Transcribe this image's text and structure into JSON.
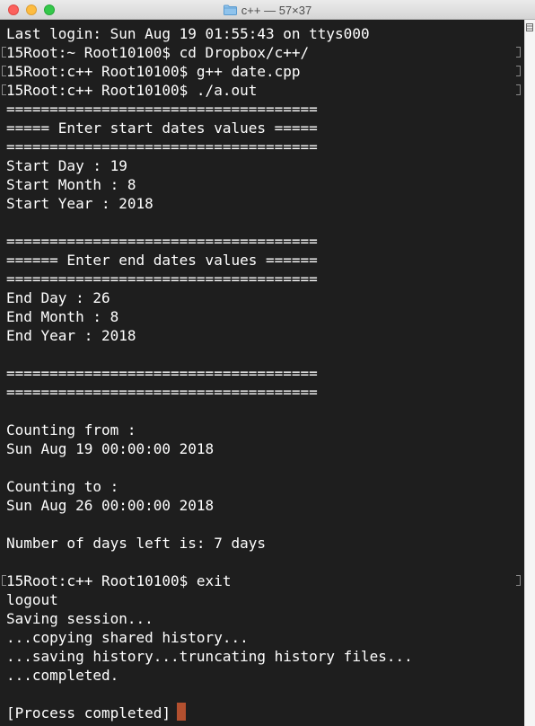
{
  "window": {
    "title": "c++ — 57×37"
  },
  "terminal": {
    "lines": [
      "Last login: Sun Aug 19 01:55:43 on ttys000",
      "15Root:~ Root10100$ cd Dropbox/c++/",
      "15Root:c++ Root10100$ g++ date.cpp",
      "15Root:c++ Root10100$ ./a.out",
      "====================================",
      "===== Enter start dates values =====",
      "====================================",
      "Start Day : 19",
      "Start Month : 8",
      "Start Year : 2018",
      "",
      "====================================",
      "====== Enter end dates values ======",
      "====================================",
      "End Day : 26",
      "End Month : 8",
      "End Year : 2018",
      "",
      "====================================",
      "====================================",
      "",
      "Counting from :",
      "Sun Aug 19 00:00:00 2018",
      "",
      "Counting to :",
      "Sun Aug 26 00:00:00 2018",
      "",
      "Number of days left is: 7 days",
      "",
      "15Root:c++ Root10100$ exit",
      "logout",
      "Saving session...",
      "...copying shared history...",
      "...saving history...truncating history files...",
      "...completed.",
      "",
      "[Process completed]"
    ]
  },
  "colors": {
    "background": "#1e1e1e",
    "text": "#ffffff",
    "cursor": "#b3502f"
  },
  "icons": {
    "folder": "folder-icon",
    "split": "split-pane-icon"
  }
}
